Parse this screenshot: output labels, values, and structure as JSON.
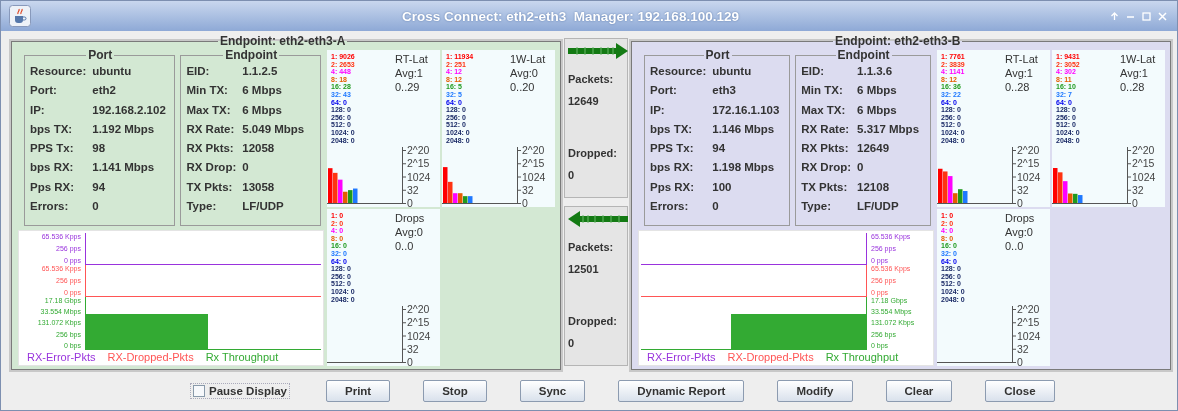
{
  "window": {
    "title": "Cross Connect: eth2-eth3  Manager: 192.168.100.129"
  },
  "endpoints": [
    {
      "title": "Endpoint: eth2-eth3-A",
      "color": "#d3e8d3",
      "port": {
        "title": "Port",
        "rows": [
          {
            "label": "Resource:",
            "value": "ubuntu"
          },
          {
            "label": "Port:",
            "value": "eth2"
          },
          {
            "label": "IP:",
            "value": "192.168.2.102"
          },
          {
            "label": "bps TX:",
            "value": "1.192 Mbps"
          },
          {
            "label": "PPS Tx:",
            "value": "98"
          },
          {
            "label": "bps RX:",
            "value": "1.141 Mbps"
          },
          {
            "label": "Pps RX:",
            "value": "94"
          },
          {
            "label": "Errors:",
            "value": "0"
          }
        ]
      },
      "endpoint": {
        "title": "Endpoint",
        "rows": [
          {
            "label": "EID:",
            "value": "1.1.2.5"
          },
          {
            "label": "Min TX:",
            "value": "6 Mbps"
          },
          {
            "label": "Max TX:",
            "value": "6 Mbps"
          },
          {
            "label": "RX Rate:",
            "value": "5.049 Mbps"
          },
          {
            "label": "RX Pkts:",
            "value": "12058"
          },
          {
            "label": "RX Drop:",
            "value": "0"
          },
          {
            "label": "TX Pkts:",
            "value": "13058"
          },
          {
            "label": "Type:",
            "value": "LF/UDP"
          }
        ]
      },
      "histograms": [
        {
          "title": "RT-Lat",
          "avg": "Avg:1",
          "range": "0..29",
          "ticks": [
            "2^20",
            "2^15",
            "1024",
            "32",
            "0"
          ],
          "buckets": [
            {
              "label": "1:",
              "value": "9026"
            },
            {
              "label": "2:",
              "value": "2653"
            },
            {
              "label": "4:",
              "value": "448"
            },
            {
              "label": "8:",
              "value": "18"
            },
            {
              "label": "16:",
              "value": "28"
            },
            {
              "label": "32:",
              "value": "43"
            },
            {
              "label": "64:",
              "value": "0"
            },
            {
              "label": "128:",
              "value": "0"
            },
            {
              "label": "256:",
              "value": "0"
            },
            {
              "label": "512:",
              "value": "0"
            },
            {
              "label": "1024:",
              "value": "0"
            },
            {
              "label": "2048:",
              "value": "0"
            }
          ]
        },
        {
          "title": "1W-Lat",
          "avg": "Avg:0",
          "range": "0..20",
          "ticks": [
            "2^20",
            "2^15",
            "1024",
            "32",
            "0"
          ],
          "buckets": [
            {
              "label": "1:",
              "value": "11934"
            },
            {
              "label": "2:",
              "value": "251"
            },
            {
              "label": "4:",
              "value": "12"
            },
            {
              "label": "8:",
              "value": "12"
            },
            {
              "label": "16:",
              "value": "5"
            },
            {
              "label": "32:",
              "value": "5"
            },
            {
              "label": "64:",
              "value": "0"
            },
            {
              "label": "128:",
              "value": "0"
            },
            {
              "label": "256:",
              "value": "0"
            },
            {
              "label": "512:",
              "value": "0"
            },
            {
              "label": "1024:",
              "value": "0"
            },
            {
              "label": "2048:",
              "value": "0"
            }
          ]
        },
        {
          "title": "Drops",
          "avg": "Avg:0",
          "range": "0..0",
          "ticks": [
            "2^20",
            "2^15",
            "1024",
            "32",
            "0"
          ],
          "buckets": [
            {
              "label": "1:",
              "value": "0"
            },
            {
              "label": "2:",
              "value": "0"
            },
            {
              "label": "4:",
              "value": "0"
            },
            {
              "label": "8:",
              "value": "0"
            },
            {
              "label": "16:",
              "value": "0"
            },
            {
              "label": "32:",
              "value": "0"
            },
            {
              "label": "64:",
              "value": "0"
            },
            {
              "label": "128:",
              "value": "0"
            },
            {
              "label": "256:",
              "value": "0"
            },
            {
              "label": "512:",
              "value": "0"
            },
            {
              "label": "1024:",
              "value": "0"
            },
            {
              "label": "2048:",
              "value": "0"
            }
          ]
        }
      ],
      "bands": [
        {
          "name": "RX-Error-Pkts",
          "kind": "line",
          "color": "#9933dd",
          "ticks": [
            "65.536 Kpps",
            "256 pps",
            "0 pps"
          ]
        },
        {
          "name": "RX-Dropped-Pkts",
          "kind": "line",
          "color": "#ff5555",
          "ticks": [
            "65.536 Kpps",
            "256 pps",
            "0 pps"
          ]
        },
        {
          "name": "Rx Throughput",
          "kind": "area",
          "color": "#33aa33",
          "ticks": [
            "17.18 Gbps",
            "33.554 Mbps",
            "131.072 Kbps",
            "256 bps",
            "0 bps"
          ]
        }
      ]
    },
    {
      "title": "Endpoint: eth2-eth3-B",
      "color": "#dcdcf0",
      "port": {
        "title": "Port",
        "rows": [
          {
            "label": "Resource:",
            "value": "ubuntu"
          },
          {
            "label": "Port:",
            "value": "eth3"
          },
          {
            "label": "IP:",
            "value": "172.16.1.103"
          },
          {
            "label": "bps TX:",
            "value": "1.146 Mbps"
          },
          {
            "label": "PPS Tx:",
            "value": "94"
          },
          {
            "label": "bps RX:",
            "value": "1.198 Mbps"
          },
          {
            "label": "Pps RX:",
            "value": "100"
          },
          {
            "label": "Errors:",
            "value": "0"
          }
        ]
      },
      "endpoint": {
        "title": "Endpoint",
        "rows": [
          {
            "label": "EID:",
            "value": "1.1.3.6"
          },
          {
            "label": "Min TX:",
            "value": "6 Mbps"
          },
          {
            "label": "Max TX:",
            "value": "6 Mbps"
          },
          {
            "label": "RX Rate:",
            "value": "5.317 Mbps"
          },
          {
            "label": "RX Pkts:",
            "value": "12649"
          },
          {
            "label": "RX Drop:",
            "value": "0"
          },
          {
            "label": "TX Pkts:",
            "value": "12108"
          },
          {
            "label": "Type:",
            "value": "LF/UDP"
          }
        ]
      },
      "histograms": [
        {
          "title": "RT-Lat",
          "avg": "Avg:1",
          "range": "0..28",
          "ticks": [
            "2^20",
            "2^15",
            "1024",
            "32",
            "0"
          ],
          "buckets": [
            {
              "label": "1:",
              "value": "7761"
            },
            {
              "label": "2:",
              "value": "3839"
            },
            {
              "label": "4:",
              "value": "1141"
            },
            {
              "label": "8:",
              "value": "12"
            },
            {
              "label": "16:",
              "value": "36"
            },
            {
              "label": "32:",
              "value": "22"
            },
            {
              "label": "64:",
              "value": "0"
            },
            {
              "label": "128:",
              "value": "0"
            },
            {
              "label": "256:",
              "value": "0"
            },
            {
              "label": "512:",
              "value": "0"
            },
            {
              "label": "1024:",
              "value": "0"
            },
            {
              "label": "2048:",
              "value": "0"
            }
          ]
        },
        {
          "title": "1W-Lat",
          "avg": "Avg:1",
          "range": "0..28",
          "ticks": [
            "2^20",
            "2^15",
            "1024",
            "32",
            "0"
          ],
          "buckets": [
            {
              "label": "1:",
              "value": "9431"
            },
            {
              "label": "2:",
              "value": "3052"
            },
            {
              "label": "4:",
              "value": "302"
            },
            {
              "label": "8:",
              "value": "11"
            },
            {
              "label": "16:",
              "value": "10"
            },
            {
              "label": "32:",
              "value": "7"
            },
            {
              "label": "64:",
              "value": "0"
            },
            {
              "label": "128:",
              "value": "0"
            },
            {
              "label": "256:",
              "value": "0"
            },
            {
              "label": "512:",
              "value": "0"
            },
            {
              "label": "1024:",
              "value": "0"
            },
            {
              "label": "2048:",
              "value": "0"
            }
          ]
        },
        {
          "title": "Drops",
          "avg": "Avg:0",
          "range": "0..0",
          "ticks": [
            "2^20",
            "2^15",
            "1024",
            "32",
            "0"
          ],
          "buckets": [
            {
              "label": "1:",
              "value": "0"
            },
            {
              "label": "2:",
              "value": "0"
            },
            {
              "label": "4:",
              "value": "0"
            },
            {
              "label": "8:",
              "value": "0"
            },
            {
              "label": "16:",
              "value": "0"
            },
            {
              "label": "32:",
              "value": "0"
            },
            {
              "label": "64:",
              "value": "0"
            },
            {
              "label": "128:",
              "value": "0"
            },
            {
              "label": "256:",
              "value": "0"
            },
            {
              "label": "512:",
              "value": "0"
            },
            {
              "label": "1024:",
              "value": "0"
            },
            {
              "label": "2048:",
              "value": "0"
            }
          ]
        }
      ],
      "bands": [
        {
          "name": "RX-Error-Pkts",
          "kind": "line",
          "color": "#9933dd",
          "ticks": [
            "65.536 Kpps",
            "256 pps",
            "0 pps"
          ]
        },
        {
          "name": "RX-Dropped-Pkts",
          "kind": "line",
          "color": "#ff5555",
          "ticks": [
            "65.536 Kpps",
            "256 pps",
            "0 pps"
          ]
        },
        {
          "name": "Rx Throughput",
          "kind": "area",
          "color": "#33aa33",
          "ticks": [
            "17.18 Gbps",
            "33.554 Mbps",
            "131.072 Kbps",
            "256 bps",
            "0 bps"
          ]
        }
      ]
    }
  ],
  "flows": [
    {
      "packets_label": "Packets:",
      "packets": "12649",
      "dropped_label": "Dropped:",
      "dropped": "0"
    },
    {
      "packets_label": "Packets:",
      "packets": "12501",
      "dropped_label": "Dropped:",
      "dropped": "0"
    }
  ],
  "controls": {
    "pause_display": {
      "label": "Pause Display",
      "checked": false
    },
    "buttons": [
      "Print",
      "Stop",
      "Sync",
      "Dynamic Report",
      "Modify",
      "Clear",
      "Close"
    ]
  }
}
